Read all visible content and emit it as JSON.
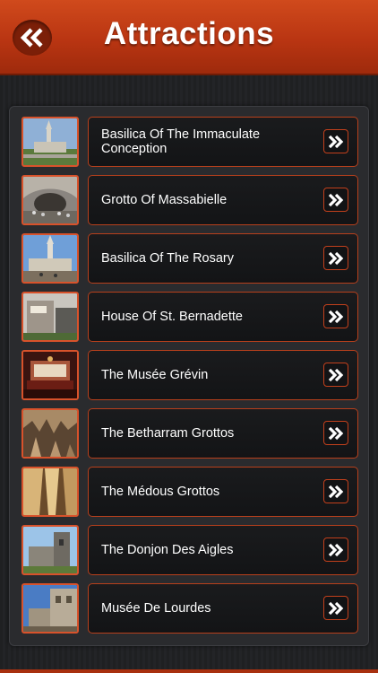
{
  "header": {
    "title": "Attractions",
    "back_icon": "double-chevron-left-icon"
  },
  "attractions": [
    {
      "name": "Basilica Of The Immaculate Conception",
      "image": "basilica-photo"
    },
    {
      "name": "Grotto Of Massabielle",
      "image": "grotto-photo"
    },
    {
      "name": "Basilica Of The Rosary",
      "image": "rosary-basilica-photo"
    },
    {
      "name": "House Of St. Bernadette",
      "image": "house-photo"
    },
    {
      "name": "The Musée Grévin",
      "image": "museum-photo"
    },
    {
      "name": "The Betharram Grottos",
      "image": "cave-photo"
    },
    {
      "name": "The Médous Grottos",
      "image": "cave-photo"
    },
    {
      "name": "The Donjon Des Aigles",
      "image": "castle-photo"
    },
    {
      "name": "Musée De Lourdes",
      "image": "building-photo"
    }
  ],
  "colors": {
    "accent": "#c2401c",
    "header": "#b93512",
    "background": "#1d1e20"
  }
}
